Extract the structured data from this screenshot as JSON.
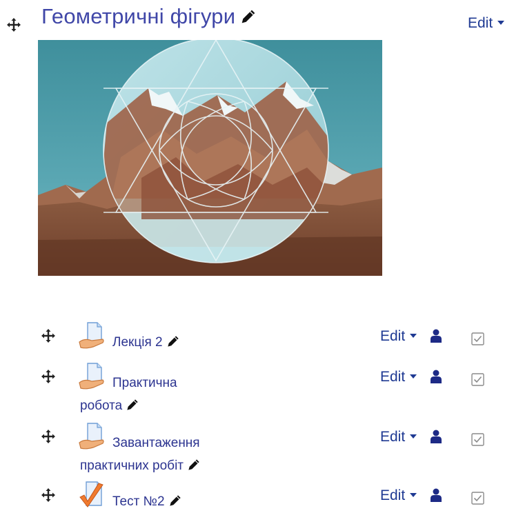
{
  "section": {
    "title": "Геометричні фігури",
    "edit_label": "Edit"
  },
  "activities": [
    {
      "name": "Лекція 2",
      "icon": "file-resource-icon",
      "edit_label": "Edit"
    },
    {
      "name": "Практична робота",
      "icon": "file-resource-icon",
      "edit_label": "Edit"
    },
    {
      "name": "Завантаження практичних робіт",
      "icon": "file-resource-icon",
      "edit_label": "Edit"
    },
    {
      "name": "Тест №2",
      "icon": "quiz-checkmark-icon",
      "edit_label": "Edit"
    }
  ],
  "colors": {
    "title": "#4047a8",
    "link": "#2c3490",
    "edit": "#1f3a93",
    "user_icon": "#1d2a86"
  }
}
